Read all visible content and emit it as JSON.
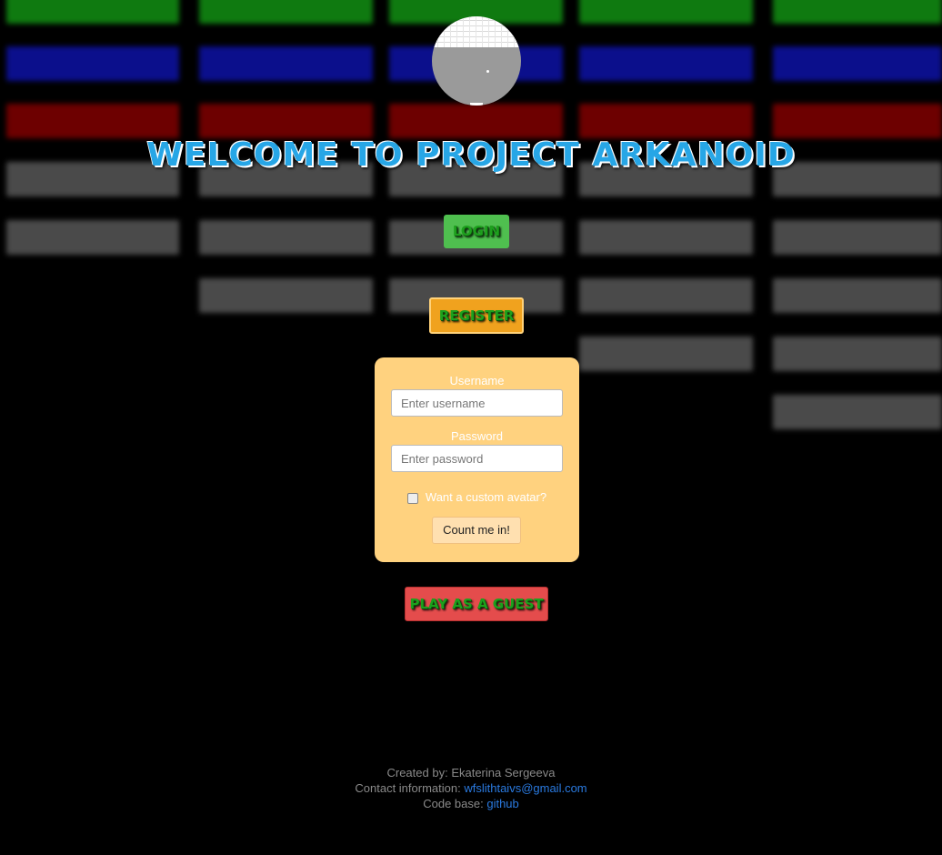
{
  "title": "Welcome to Project Arkanoid",
  "buttons": {
    "login": "Login",
    "register": "Register",
    "guest": "Play as a guest"
  },
  "form": {
    "username_label": "Username",
    "username_placeholder": "Enter username",
    "password_label": "Password",
    "password_placeholder": "Enter password",
    "avatar_label": "Want a custom avatar?",
    "avatar_checked": false,
    "submit_label": "Count me in!"
  },
  "footer": {
    "created_prefix": "Created by:",
    "created_name": "Ekaterina Sergeeva",
    "contact_prefix": "Contact information:",
    "contact_email": "wfslithtaivs@gmail.com",
    "code_prefix": "Code base:",
    "code_link": "github"
  },
  "colors": {
    "title": "#27a6e6",
    "login_bg": "#4fbf4f",
    "register_bg": "#f0a21e",
    "guest_bg": "#e44c4c",
    "form_bg": "#ffd27f",
    "link": "#2a7ae0"
  },
  "logo_icon": "arkanoid-game-preview"
}
